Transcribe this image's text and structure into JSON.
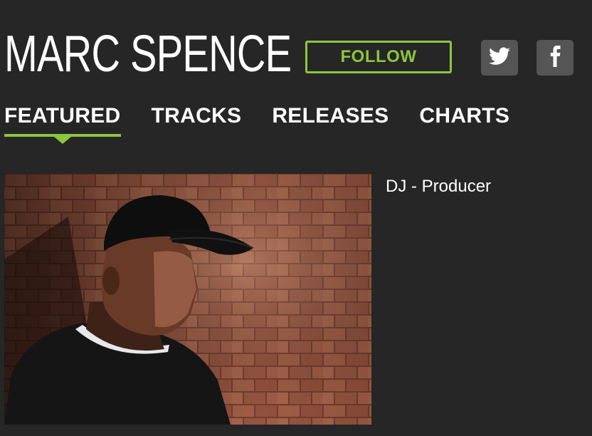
{
  "artist": {
    "name": "MARC SPENCE",
    "bio": "DJ - Producer"
  },
  "actions": {
    "follow_label": "FOLLOW"
  },
  "social": [
    {
      "icon": "twitter-icon"
    },
    {
      "icon": "facebook-icon"
    }
  ],
  "nav": {
    "tabs": [
      {
        "label": "FEATURED",
        "active": true
      },
      {
        "label": "TRACKS",
        "active": false
      },
      {
        "label": "RELEASES",
        "active": false
      },
      {
        "label": "CHARTS",
        "active": false
      }
    ]
  },
  "colors": {
    "background": "#262626",
    "accent": "#8cc63f",
    "social_button": "#555555",
    "text": "#ffffff"
  }
}
